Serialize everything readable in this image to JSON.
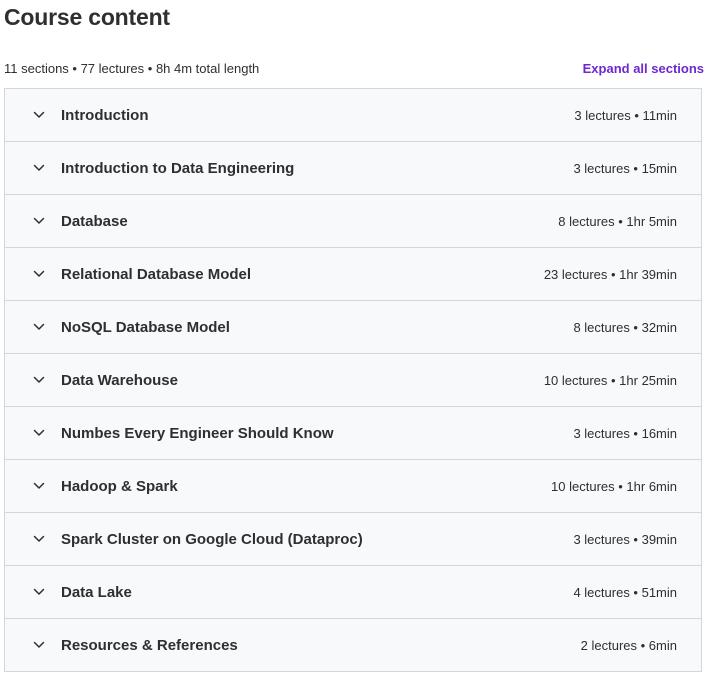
{
  "header": {
    "title": "Course content",
    "summary": "11 sections • 77 lectures • 8h 4m total length",
    "expand_all_label": "Expand all sections"
  },
  "icons": {
    "chevron": "chevron-down-icon"
  },
  "colors": {
    "accent": "#6d28d2",
    "section_bg": "#f7f9fa",
    "border": "#d1d7dc",
    "text": "#2d2f31"
  },
  "sections": [
    {
      "title": "Introduction",
      "meta": "3 lectures • 11min"
    },
    {
      "title": "Introduction to Data Engineering",
      "meta": "3 lectures • 15min"
    },
    {
      "title": "Database",
      "meta": "8 lectures • 1hr 5min"
    },
    {
      "title": "Relational Database Model",
      "meta": "23 lectures • 1hr 39min"
    },
    {
      "title": "NoSQL Database Model",
      "meta": "8 lectures • 32min"
    },
    {
      "title": "Data Warehouse",
      "meta": "10 lectures • 1hr 25min"
    },
    {
      "title": "Numbes Every Engineer Should Know",
      "meta": "3 lectures • 16min"
    },
    {
      "title": "Hadoop & Spark",
      "meta": "10 lectures • 1hr 6min"
    },
    {
      "title": "Spark Cluster on Google Cloud (Dataproc)",
      "meta": "3 lectures • 39min"
    },
    {
      "title": "Data Lake",
      "meta": "4 lectures • 51min"
    },
    {
      "title": "Resources & References",
      "meta": "2 lectures • 6min"
    }
  ]
}
